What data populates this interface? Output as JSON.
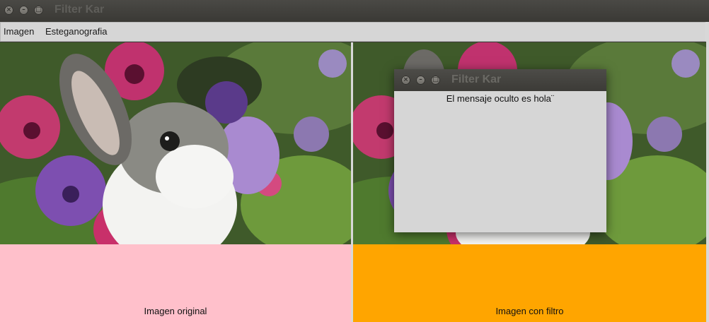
{
  "window": {
    "title": "Filter Kar",
    "controls": {
      "close": "×",
      "minimize": "–",
      "maximize": "□"
    }
  },
  "menubar": {
    "items": [
      {
        "label": "Imagen"
      },
      {
        "label": "Esteganografia"
      }
    ]
  },
  "panels": {
    "left": {
      "caption": "Imagen original",
      "background": "#ffc0cb"
    },
    "right": {
      "caption": "Imagen con filtro",
      "background": "#ffa500"
    }
  },
  "dialog": {
    "title": "Filter Kar",
    "message": "El mensaje oculto es hola¨"
  }
}
